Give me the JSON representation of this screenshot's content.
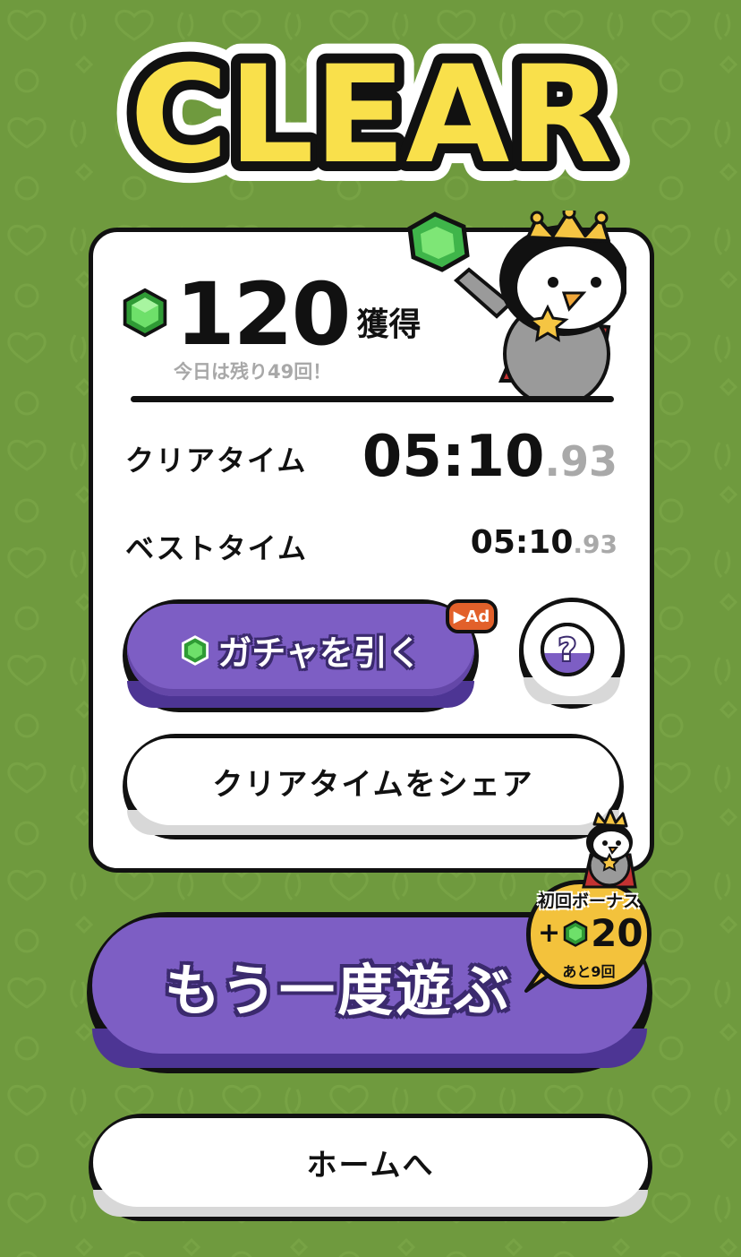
{
  "title": "CLEAR",
  "reward": {
    "gem_count": "120",
    "gem_suffix": "獲得",
    "remaining_text": "今日は残り49回！"
  },
  "times": {
    "clear_label": "クリアタイム",
    "clear_main": "05:10",
    "clear_ms": ".93",
    "best_label": "ベストタイム",
    "best_main": "05:10",
    "best_ms": ".93"
  },
  "buttons": {
    "gacha_label": "ガチャを引く",
    "ad_label": "▶Ad",
    "help_label": "?",
    "share_label": "クリアタイムをシェア",
    "retry_label": "もう一度遊ぶ",
    "home_label": "ホームへ"
  },
  "bonus": {
    "title": "初回ボーナス",
    "plus": "+",
    "amount": "20",
    "remaining": "あと9回"
  },
  "colors": {
    "background": "#6f9a3e",
    "title_yellow": "#f9e04b",
    "purple": "#7d5ec4",
    "gem_green": "#4fd04a",
    "bonus_yellow": "#f3c23c",
    "ad_orange": "#e2602a",
    "ms_gray": "#a9a9a9"
  },
  "icons": {
    "gem": "green-gem-icon",
    "help": "question-icon",
    "mascot": "crowned-penguin"
  }
}
